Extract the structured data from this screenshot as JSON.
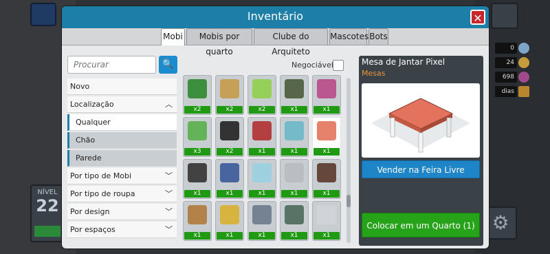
{
  "window": {
    "title": "Inventário"
  },
  "tabs": [
    {
      "label": "Mobi",
      "active": true
    },
    {
      "label": "Mobis por quarto",
      "active": false
    },
    {
      "label": "Clube do Arquiteto",
      "active": false
    },
    {
      "label": "Mascotes",
      "active": false
    },
    {
      "label": "Bots",
      "active": false
    }
  ],
  "search": {
    "placeholder": "Procurar"
  },
  "filters": {
    "novo": "Novo",
    "localizacao": "Localização",
    "qualquer": "Qualquer",
    "chao": "Chão",
    "parede": "Parede",
    "por_tipo_mobi": "Por tipo de Mobi",
    "por_tipo_roupa": "Por tipo de roupa",
    "por_design": "Por design",
    "por_espacos": "Por espaços"
  },
  "negociavel": {
    "label": "Negociável",
    "checked": false
  },
  "items": [
    {
      "icon": "strawberry-plant-icon",
      "count": "x2"
    },
    {
      "icon": "hay-bale-icon",
      "count": "x2"
    },
    {
      "icon": "vending-machine-icon",
      "count": "x2"
    },
    {
      "icon": "dragon-head-icon",
      "count": "x1"
    },
    {
      "icon": "flower-bouquet-icon",
      "count": "x1"
    },
    {
      "icon": "green-doll-icon",
      "count": "x3"
    },
    {
      "icon": "penguin-icon",
      "count": "x2"
    },
    {
      "icon": "rocking-toy-icon",
      "count": "x1"
    },
    {
      "icon": "aquarium-table-icon",
      "count": "x1"
    },
    {
      "icon": "pixel-table-icon",
      "count": "x1",
      "selected": true
    },
    {
      "icon": "turntable-icon",
      "count": "x1"
    },
    {
      "icon": "blue-screen-icon",
      "count": "x1"
    },
    {
      "icon": "glass-table-icon",
      "count": "x1"
    },
    {
      "icon": "grey-stone-icon",
      "count": "x1"
    },
    {
      "icon": "dark-cabinet-icon",
      "count": "x1"
    },
    {
      "icon": "desk-icon",
      "count": "x1"
    },
    {
      "icon": "corn-icon",
      "count": "x1"
    },
    {
      "icon": "rock-pile-icon",
      "count": "x1"
    },
    {
      "icon": "statue-icon",
      "count": "x1"
    },
    {
      "icon": "trash-can-icon",
      "count": "x1"
    }
  ],
  "preview": {
    "name": "Mesa de Jantar Pixel",
    "category": "Mesas",
    "sell_label": "Vender na Feira Livre",
    "place_label": "Colocar em um Quarto (1)"
  },
  "hud": {
    "level_label": "NÍVEL",
    "level_value": "22",
    "stat_diamonds": "0",
    "stat_credits": "24",
    "stat_duckets": "698",
    "stat_days": "dias"
  },
  "colors": {
    "titlebar": "#1d7fa8",
    "badge": "#1f9a12",
    "accent_orange": "#e8943a"
  }
}
